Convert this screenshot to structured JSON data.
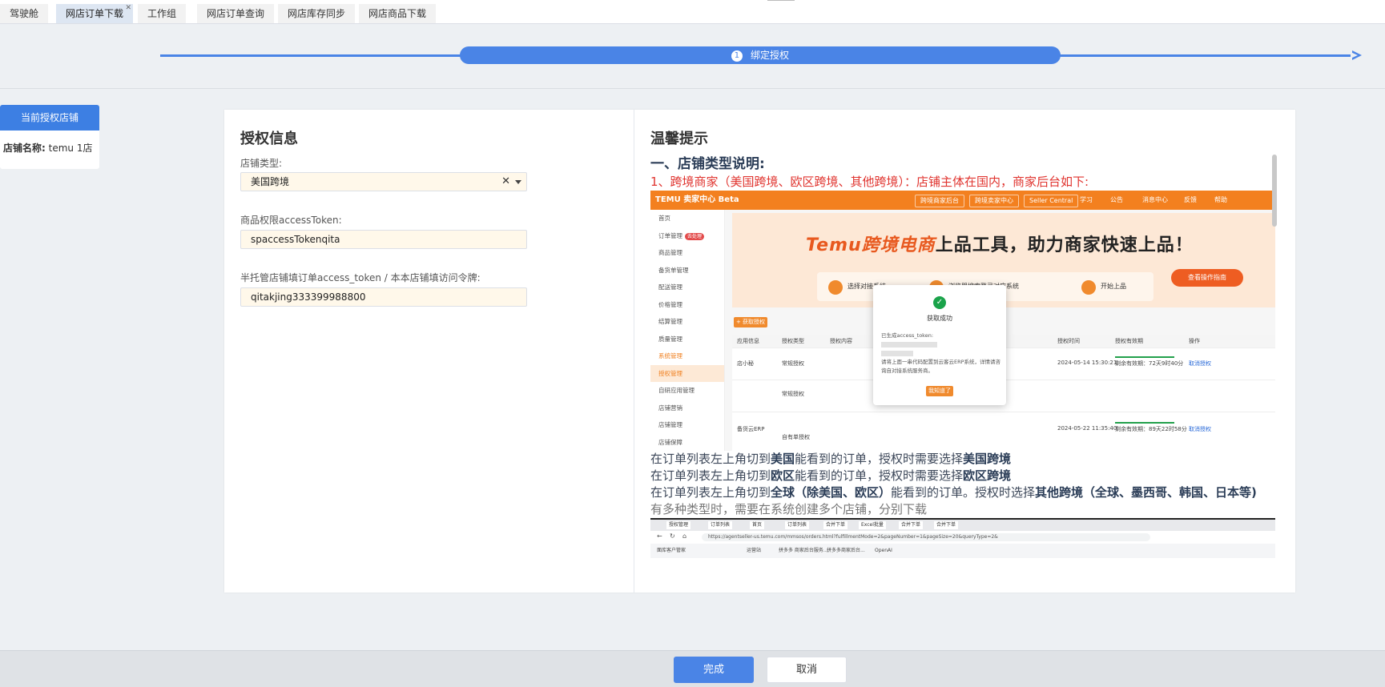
{
  "tabs": [
    {
      "label": "驾驶舱"
    },
    {
      "label": "网店订单下载",
      "active": true
    },
    {
      "label": "工作组"
    },
    {
      "label": "网店订单查询"
    },
    {
      "label": "网店库存同步"
    },
    {
      "label": "网店商品下载"
    }
  ],
  "stepper": {
    "number": "1",
    "label": "绑定授权"
  },
  "left_panel": {
    "button": "当前授权店铺",
    "store_key": "店铺名称:",
    "store_value": "temu 1店"
  },
  "auth": {
    "title": "授权信息",
    "store_type_label": "店铺类型:",
    "store_type_value": "美国跨境",
    "token_label": "商品权限accessToken:",
    "token_value": "spaccessTokenqita",
    "order_token_label": "半托管店铺填订单access_token / 本本店铺填访问令牌:",
    "order_token_value": "qitakjing333399988800"
  },
  "tips": {
    "title": "温馨提示",
    "heading": "一、店铺类型说明:",
    "red_line": "1、跨境商家（美国跨境、欧区跨境、其他跨境）：店铺主体在国内，商家后台如下:",
    "line1_a": "在订单列表左上角切到",
    "line1_b": "美国",
    "line1_c": "能看到的订单，授权时需要选择",
    "line1_d": "美国跨境",
    "line2_a": "在订单列表左上角切到",
    "line2_b": "欧区",
    "line2_c": "能看到的订单，授权时需要选择",
    "line2_d": "欧区跨境",
    "line3_a": "在订单列表左上角切到",
    "line3_b": "全球（除美国、欧区）",
    "line3_c": "能看到的订单。授权时选择",
    "line3_d": "其他跨境（全球、墨西哥、韩国、日本等)",
    "gray_line": "有多种类型时，需要在系统创建多个店铺，分别下载"
  },
  "screenshot1": {
    "brand": "TEMU 卖家中心 Beta",
    "top_pills": [
      "跨境商家后台",
      "跨境卖家中心",
      "Seller Central"
    ],
    "top_nav": [
      "学习",
      "公告",
      "消息中心",
      "反馈",
      "帮助"
    ],
    "sidebar": [
      "首页",
      "订单管理",
      "商品管理",
      "备货单管理",
      "配送管理",
      "价格管理",
      "结算管理",
      "质量管理",
      "系统管理",
      "授权管理",
      "自研应用管理",
      "店铺营销",
      "店铺管理",
      "店铺保障"
    ],
    "sidebar_badge": "去处理",
    "banner_title": "Temu跨境电商",
    "banner_title_tail": "上品工具，助力商家快速上品！",
    "banner_steps": [
      "选择对接系统",
      "浏览器搜索登录对应系统",
      "开始上品"
    ],
    "banner_button": "查看操作指南",
    "add_button": "+ 获取授权",
    "table_headers": [
      "应用信息",
      "授权类型",
      "授权内容",
      "授权时间",
      "授权有效期",
      "操作"
    ],
    "rows": [
      {
        "app": "店小秘",
        "type": "常规授权",
        "time": "2024-05-14 15:30:21",
        "validity": "剩余有效期：72天9时40分",
        "op": "取消授权"
      },
      {
        "app": "",
        "type": "常规授权",
        "time": "",
        "validity": "",
        "op": ""
      },
      {
        "app": "备货云ERP",
        "type": "自有单授权",
        "time": "2024-05-22 11:35:40",
        "validity": "剩余有效期：89天22时58分",
        "op": "取消授权"
      }
    ],
    "modal_title": "获取成功",
    "modal_token_label": "已生成access_token:",
    "modal_text": "请将上面一串代码配置到云客云ERP系统，详情请咨询自对接系统服务商。",
    "modal_button": "我知道了"
  },
  "screenshot2": {
    "tabs": [
      "授权管理",
      "订单列表",
      "首页",
      "订单列表",
      "合并下单",
      "Excel批量",
      "合并下单",
      "合并下单"
    ],
    "url": "https://agentseller-us.temu.com/mmsos/orders.html?fulfillmentMode=2&pageNumber=1&pageSize=20&queryType=2&",
    "bookmarks": [
      "面库客户管家",
      "运营站",
      "拼多多 商家后台服务...",
      "拼多多商家后台...",
      "OpenAI"
    ]
  },
  "footer": {
    "ok": "完成",
    "cancel": "取消"
  }
}
